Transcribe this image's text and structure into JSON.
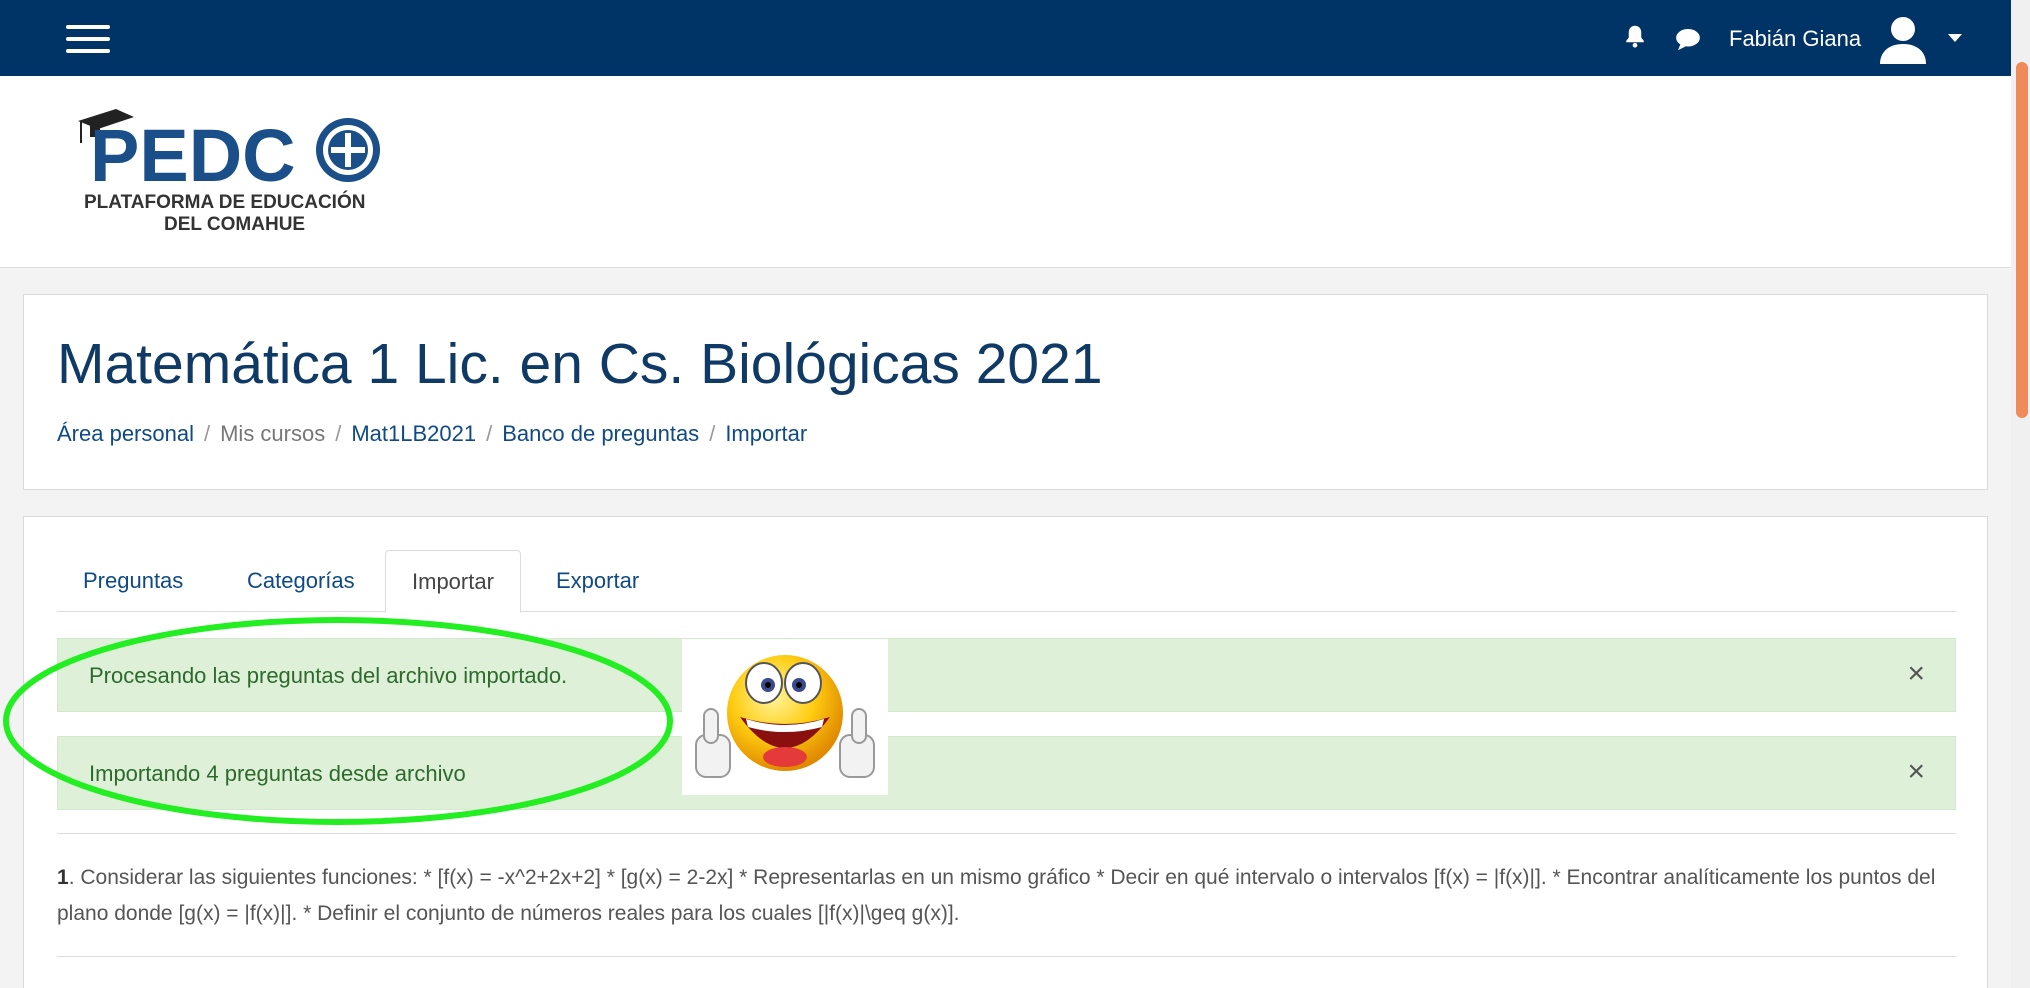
{
  "topbar": {
    "menu_icon": "hamburger-icon",
    "notification_icon": "bell-icon",
    "messages_icon": "chat-bubble-icon",
    "user_name": "Fabián Giana",
    "avatar_icon": "user-avatar-icon",
    "user_menu_icon": "caret-down-icon",
    "bg_color": "#003366"
  },
  "logo": {
    "brand": "PEDCO",
    "line1": "PLATAFORMA DE EDUCACIÓN",
    "line2": "DEL COMAHUE"
  },
  "page": {
    "title": "Matemática 1 Lic. en Cs. Biológicas 2021"
  },
  "breadcrumb": {
    "items": [
      "Área personal",
      "Mis cursos",
      "Mat1LB2021",
      "Banco de preguntas",
      "Importar"
    ],
    "separator": "/"
  },
  "tabs": [
    {
      "label": "Preguntas",
      "active": false
    },
    {
      "label": "Categorías",
      "active": false
    },
    {
      "label": "Importar",
      "active": true
    },
    {
      "label": "Exportar",
      "active": false
    }
  ],
  "alerts": [
    {
      "message": "Procesando las preguntas del archivo importado.",
      "close": "×"
    },
    {
      "message": "Importando 4 preguntas desde archivo",
      "close": "×"
    }
  ],
  "question": {
    "number": "1",
    "text": ". Considerar las siguientes funciones: * [f(x) = -x^2+2x+2] * [g(x) = 2-2x] * Representarlas en un mismo gráfico * Decir en qué intervalo o intervalos [f(x) = |f(x)|]. * Encontrar analíticamente los puntos del plano donde [g(x) = |f(x)|]. * Definir el conjunto de números reales para los cuales [|f(x)|\\geq g(x)]."
  },
  "colors": {
    "alert_bg": "#dff0d8",
    "link": "#0f4a86",
    "highlight": "#22ee22"
  }
}
